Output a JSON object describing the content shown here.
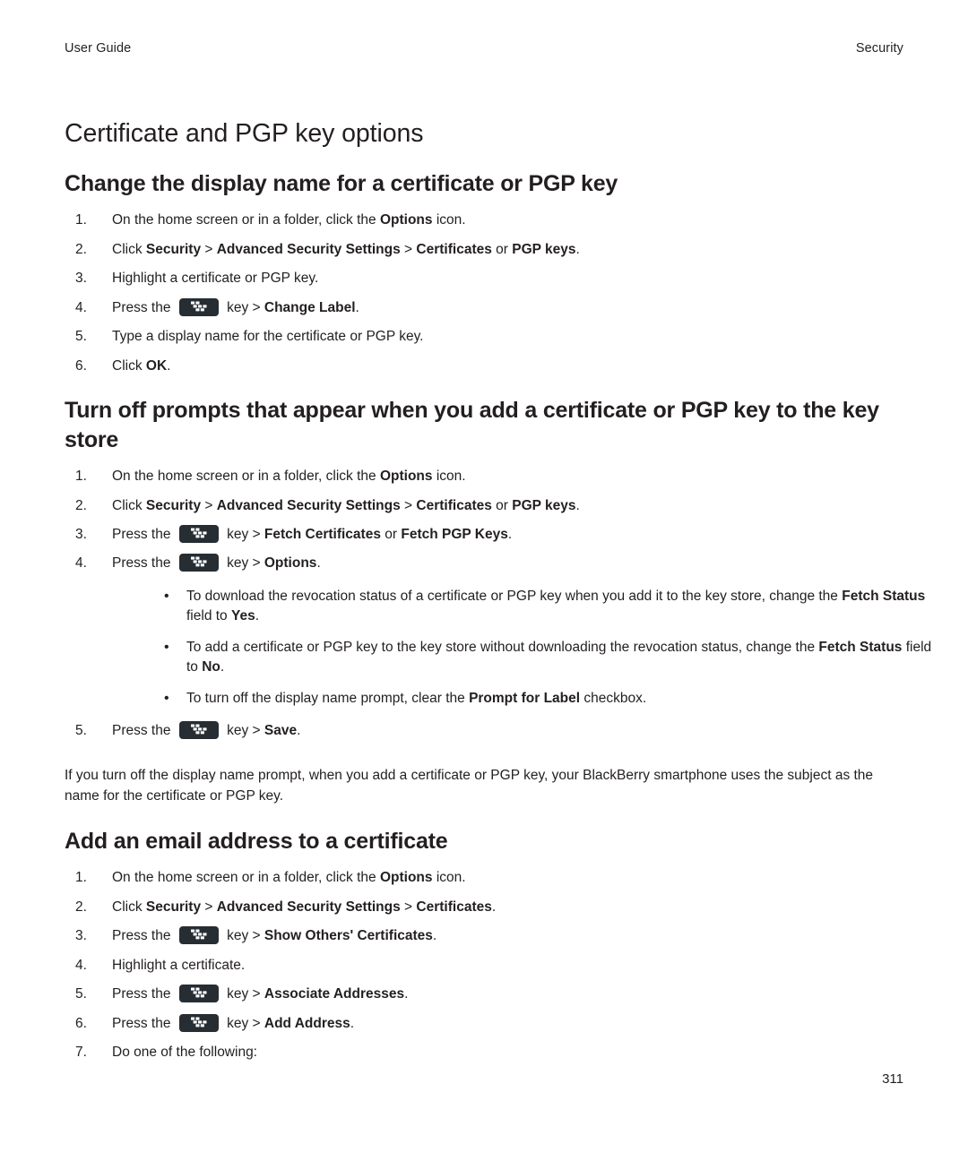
{
  "header": {
    "left": "User Guide",
    "right": "Security"
  },
  "chapter_title": "Certificate and PGP key options",
  "sections": [
    {
      "title": "Change the display name for a certificate or PGP key",
      "steps": [
        "On the home screen or in a folder, click the Options icon.",
        "Click Security > Advanced Security Settings > Certificates or PGP keys.",
        "Highlight a certificate or PGP key.",
        "Press the [menu-key] key > Change Label.",
        "Type a display name for the certificate or PGP key.",
        "Click OK."
      ]
    },
    {
      "title": "Turn off prompts that appear when you add a certificate or PGP key to the key store",
      "steps": [
        "On the home screen or in a folder, click the Options icon.",
        "Click Security > Advanced Security Settings > Certificates or PGP keys.",
        "Press the [menu-key] key > Fetch Certificates or Fetch PGP Keys.",
        "Press the [menu-key] key > Options.",
        "Press the [menu-key] key > Save."
      ],
      "bullets": [
        "To download the revocation status of a certificate or PGP key when you add it to the key store, change the Fetch Status field to Yes.",
        "To add a certificate or PGP key to the key store without downloading the revocation status, change the Fetch Status field to No.",
        "To turn off the display name prompt, clear the Prompt for Label checkbox."
      ],
      "closing_paragraph": "If you turn off the display name prompt, when you add a certificate or PGP key, your BlackBerry smartphone uses the subject as the name for the certificate or PGP key."
    },
    {
      "title": "Add an email address to a certificate",
      "steps": [
        "On the home screen or in a folder, click the Options icon.",
        "Click Security > Advanced Security Settings > Certificates.",
        "Press the [menu-key] key > Show Others' Certificates.",
        "Highlight a certificate.",
        "Press the [menu-key] key > Associate Addresses.",
        "Press the [menu-key] key > Add Address.",
        "Do one of the following:"
      ]
    }
  ],
  "step_text": {
    "s1_1_a": "On the home screen or in a folder, click the ",
    "s1_1_b": "Options",
    "s1_1_c": " icon.",
    "s1_2_a": "Click ",
    "s1_2_security": "Security",
    "s1_2_gt1": " > ",
    "s1_2_advanced": "Advanced Security Settings",
    "s1_2_gt2": " > ",
    "s1_2_certificates": "Certificates",
    "s1_2_or": " or ",
    "s1_2_pgpkeys": "PGP keys",
    "s1_2_end": ".",
    "s1_3": "Highlight a certificate or PGP key.",
    "s1_4_a": "Press the ",
    "s1_4_b": " key > ",
    "s1_4_c": "Change Label",
    "s1_4_d": ".",
    "s1_5": "Type a display name for the certificate or PGP key.",
    "s1_6_a": "Click ",
    "s1_6_b": "OK",
    "s1_6_c": ".",
    "s2_3_a": "Press the ",
    "s2_3_b": " key > ",
    "s2_3_fetchcert": "Fetch Certificates",
    "s2_3_or": " or ",
    "s2_3_fetchpgp": "Fetch PGP Keys",
    "s2_3_end": ".",
    "s2_4_a": "Press the ",
    "s2_4_b": " key > ",
    "s2_4_c": "Options",
    "s2_4_d": ".",
    "s2_5_a": "Press the ",
    "s2_5_b": " key > ",
    "s2_5_c": "Save",
    "s2_5_d": ".",
    "b1_a": "To download the revocation status of a certificate or PGP key when you add it to the key store, change the ",
    "b1_b": "Fetch Status",
    "b1_c": " field to ",
    "b1_d": "Yes",
    "b1_e": ".",
    "b2_a": "To add a certificate or PGP key to the key store without downloading the revocation status, change the ",
    "b2_b": "Fetch Status",
    "b2_c": " field to ",
    "b2_d": "No",
    "b2_e": ".",
    "b3_a": "To turn off the display name prompt, clear the ",
    "b3_b": "Prompt for Label",
    "b3_c": " checkbox.",
    "s3_2_a": "Click ",
    "s3_2_security": "Security",
    "s3_2_gt1": " > ",
    "s3_2_advanced": "Advanced Security Settings",
    "s3_2_gt2": " > ",
    "s3_2_certificates": "Certificates",
    "s3_2_end": ".",
    "s3_3_a": "Press the ",
    "s3_3_b": " key > ",
    "s3_3_c": "Show Others' Certificates",
    "s3_3_d": ".",
    "s3_4": "Highlight a certificate.",
    "s3_5_a": "Press the ",
    "s3_5_b": " key > ",
    "s3_5_c": "Associate Addresses",
    "s3_5_d": ".",
    "s3_6_a": "Press the ",
    "s3_6_b": " key > ",
    "s3_6_c": "Add Address",
    "s3_6_d": ".",
    "s3_7": "Do one of the following:"
  },
  "icons": {
    "menu_key": "blackberry-menu-key-icon"
  },
  "colors": {
    "text": "#231f20",
    "menu_key_background": "#262d33",
    "menu_key_glyph": "#ffffff",
    "page_background": "#ffffff"
  },
  "folio": "311"
}
